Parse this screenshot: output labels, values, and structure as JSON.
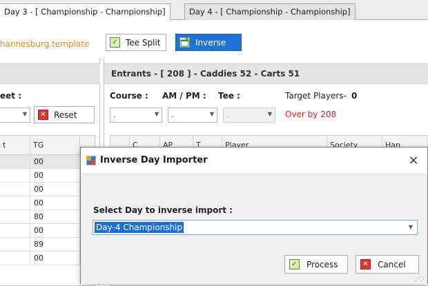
{
  "tabs": [
    {
      "label": "Day 3 - [ Championship - Championship]",
      "active": true
    },
    {
      "label": "Day 4 - [ Championship - Championship]",
      "active": false
    }
  ],
  "toolbar": {
    "template_name": "hannesburg.template",
    "tee_split_label": "Tee Split",
    "inverse_label": "Inverse"
  },
  "left_panel": {
    "header": "",
    "sheet_label": "eet :",
    "reset_label": "Reset",
    "grid": {
      "headers": [
        "t",
        "TG"
      ],
      "rows": [
        [
          "",
          "00"
        ],
        [
          "",
          "00"
        ],
        [
          "",
          "00"
        ],
        [
          "",
          "00"
        ],
        [
          "",
          "80"
        ],
        [
          "",
          "00"
        ],
        [
          "",
          "89"
        ],
        [
          "",
          "00"
        ]
      ]
    }
  },
  "right_panel": {
    "header": "Entrants - [ 208 ] - Caddies 52 - Carts 51",
    "course_label": "Course :",
    "ampm_label": "AM / PM :",
    "tee_label": "Tee :",
    "target_label": "Target Players-",
    "target_value": "0",
    "course_value": ".",
    "ampm_value": ".",
    "tee_value": ".",
    "over_text": "Over by 208",
    "grid": {
      "headers": [
        "",
        "C",
        "AP",
        "T",
        "Player",
        "Society",
        "Han"
      ]
    }
  },
  "dialog": {
    "title": "Inverse Day Importer",
    "close_symbol": "×",
    "label": "Select Day to inverse  import :",
    "selected_value": "Day-4 Championship",
    "process_label": "Process",
    "cancel_label": "Cancel"
  },
  "colors": {
    "accent_blue": "#1e73d6",
    "template_orange": "#e88a15",
    "over_red": "#e0221a"
  },
  "icons": {
    "check": "✓",
    "x": "✕",
    "chevron": "▼"
  }
}
